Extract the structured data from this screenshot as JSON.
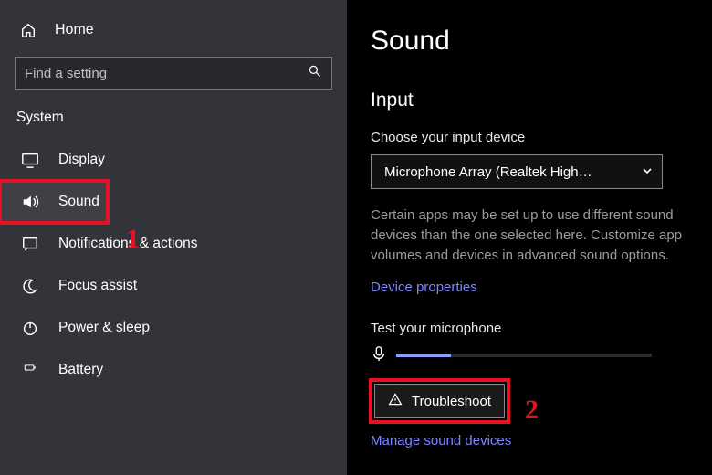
{
  "sidebar": {
    "home": "Home",
    "search_placeholder": "Find a setting",
    "group": "System",
    "items": [
      {
        "icon": "display-icon",
        "label": "Display"
      },
      {
        "icon": "sound-icon",
        "label": "Sound"
      },
      {
        "icon": "notifications-icon",
        "label": "Notifications & actions"
      },
      {
        "icon": "focus-assist-icon",
        "label": "Focus assist"
      },
      {
        "icon": "power-icon",
        "label": "Power & sleep"
      },
      {
        "icon": "battery-icon",
        "label": "Battery"
      }
    ]
  },
  "main": {
    "title": "Sound",
    "input_section": "Input",
    "choose_label": "Choose your input device",
    "device_selected": "Microphone Array (Realtek High…",
    "help_text": "Certain apps may be set up to use different sound devices than the one selected here. Customize app volumes and devices in advanced sound options.",
    "device_props": "Device properties",
    "test_label": "Test your microphone",
    "troubleshoot": "Troubleshoot",
    "manage_link": "Manage sound devices"
  },
  "annotations": {
    "badge1": "1",
    "badge2": "2",
    "color": "#e81123"
  }
}
